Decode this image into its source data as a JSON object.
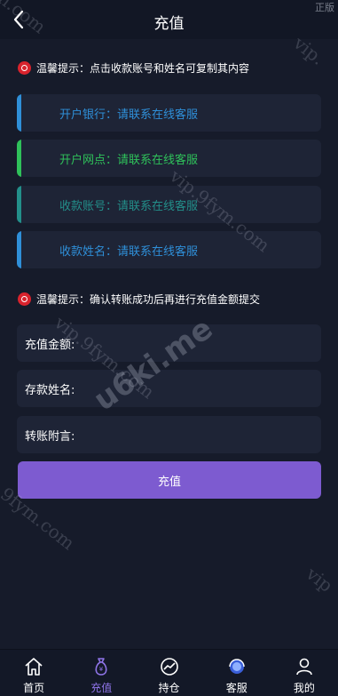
{
  "header": {
    "title": "充值",
    "corner_tag": "正版"
  },
  "tips": {
    "top": "温馨提示：点击收款账号和姓名可复制其内容",
    "middle": "温馨提示：确认转账成功后再进行充值金额提交"
  },
  "info_cards": [
    {
      "text": "开户银行：请联系在线客服",
      "color": "#2f8fd8"
    },
    {
      "text": "开户网点：请联系在线客服",
      "color": "#2fc15a"
    },
    {
      "text": "收款账号：请联系在线客服",
      "color": "#238f8a"
    },
    {
      "text": "收款姓名：请联系在线客服",
      "color": "#2f8fd8"
    }
  ],
  "form": {
    "amount_label": "充值金额:",
    "name_label": "存款姓名:",
    "note_label": "转账附言:",
    "submit_label": "充值"
  },
  "watermarks": {
    "main": "u6ki.me",
    "a": "vip.9fym.com",
    "b": "vip.9fym.com",
    "c": "vip.9fym.com",
    "d": "vip.",
    "e": "n.com",
    "f": "vip"
  },
  "tabs": [
    {
      "label": "首页",
      "icon": "home-icon"
    },
    {
      "label": "充值",
      "icon": "money-bag-icon",
      "active": true
    },
    {
      "label": "持仓",
      "icon": "chart-icon"
    },
    {
      "label": "客服",
      "icon": "service-icon"
    },
    {
      "label": "我的",
      "icon": "user-icon"
    }
  ],
  "colors": {
    "accent": "#7d5bd0",
    "background": "#161b2a",
    "card": "#1e2436"
  }
}
